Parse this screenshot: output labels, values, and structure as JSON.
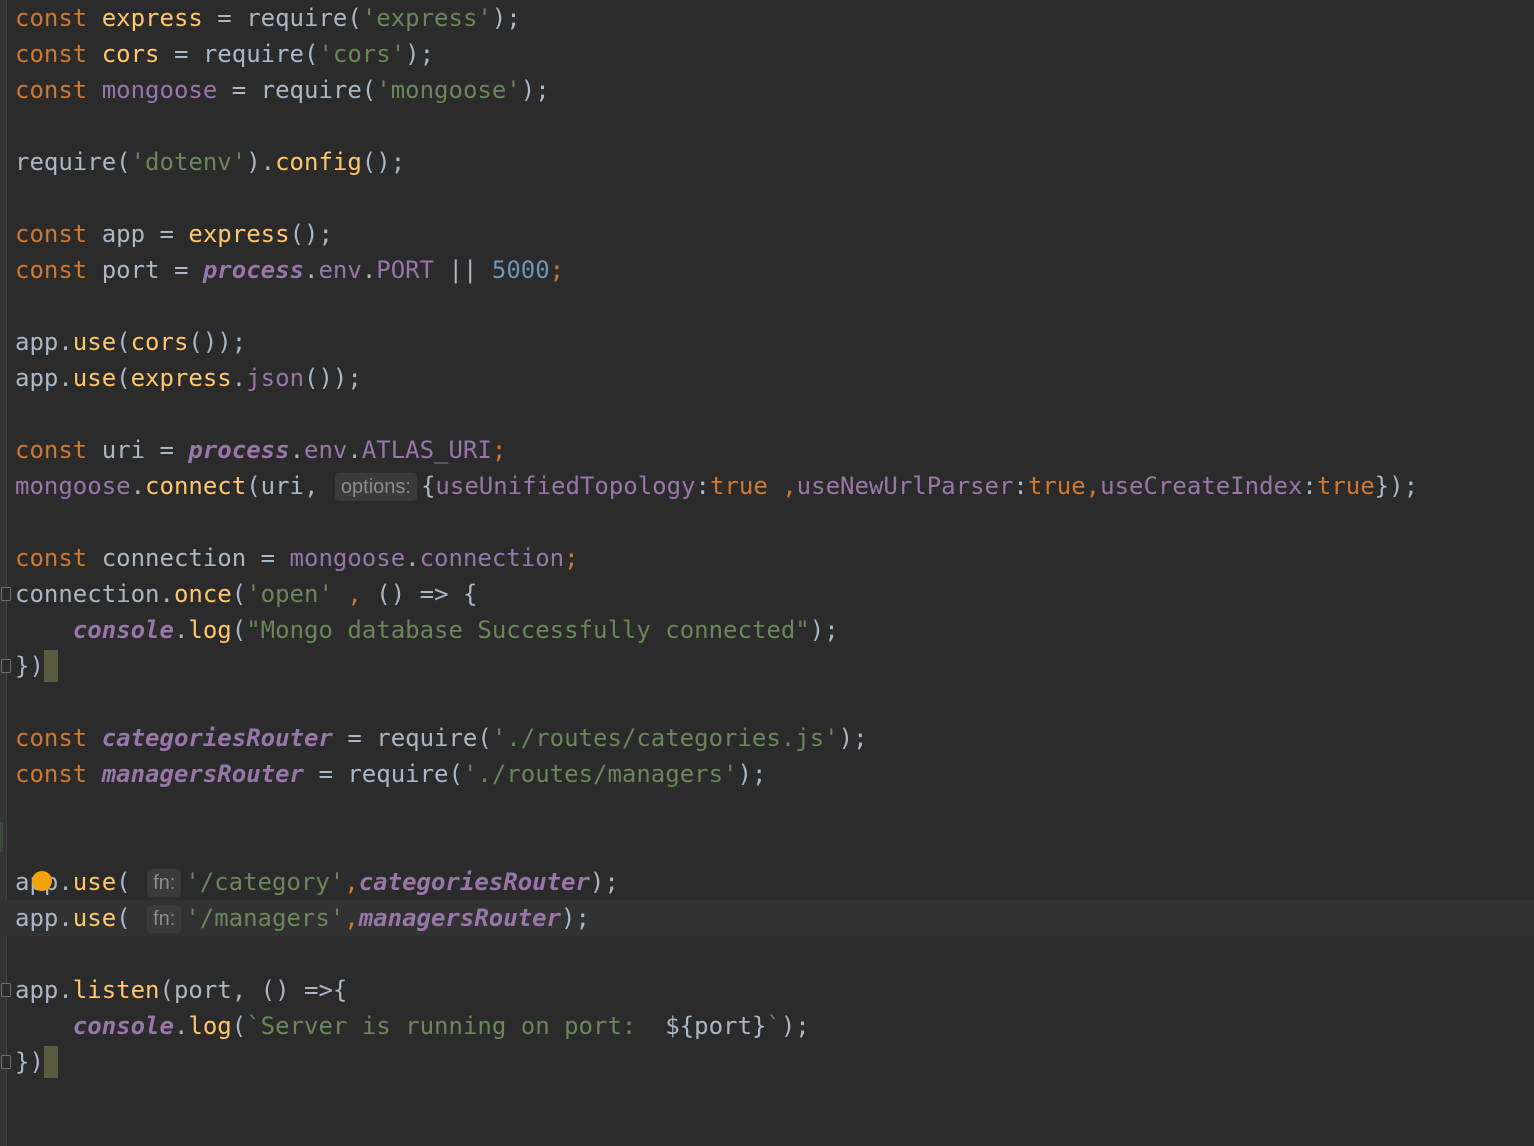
{
  "editor": {
    "language": "javascript",
    "current_line_index": 25,
    "lines": [
      [
        {
          "t": "const ",
          "c": "kw"
        },
        {
          "t": "express",
          "c": "fn"
        },
        {
          "t": " = require(",
          "c": "var"
        },
        {
          "t": "'express'",
          "c": "str"
        },
        {
          "t": ");",
          "c": "var"
        }
      ],
      [
        {
          "t": "const ",
          "c": "kw"
        },
        {
          "t": "cors",
          "c": "fn"
        },
        {
          "t": " = require(",
          "c": "var"
        },
        {
          "t": "'cors'",
          "c": "str"
        },
        {
          "t": ");",
          "c": "var"
        }
      ],
      [
        {
          "t": "const ",
          "c": "kw"
        },
        {
          "t": "mongoose",
          "c": "prop"
        },
        {
          "t": " = require(",
          "c": "var"
        },
        {
          "t": "'mongoose'",
          "c": "str"
        },
        {
          "t": ");",
          "c": "var"
        }
      ],
      [],
      [
        {
          "t": "require(",
          "c": "var"
        },
        {
          "t": "'dotenv'",
          "c": "str"
        },
        {
          "t": ").",
          "c": "var"
        },
        {
          "t": "config",
          "c": "fn"
        },
        {
          "t": "();",
          "c": "var"
        }
      ],
      [],
      [
        {
          "t": "const ",
          "c": "kw"
        },
        {
          "t": "app = ",
          "c": "var"
        },
        {
          "t": "express",
          "c": "fn"
        },
        {
          "t": "();",
          "c": "var"
        }
      ],
      [
        {
          "t": "const ",
          "c": "kw"
        },
        {
          "t": "port = ",
          "c": "var"
        },
        {
          "t": "process",
          "c": "glob"
        },
        {
          "t": ".",
          "c": "var"
        },
        {
          "t": "env",
          "c": "prop"
        },
        {
          "t": ".",
          "c": "var"
        },
        {
          "t": "PORT",
          "c": "prop"
        },
        {
          "t": " || ",
          "c": "var"
        },
        {
          "t": "5000",
          "c": "num"
        },
        {
          "t": ";",
          "c": "punc"
        }
      ],
      [],
      [
        {
          "t": "app.",
          "c": "var"
        },
        {
          "t": "use",
          "c": "fn"
        },
        {
          "t": "(",
          "c": "var"
        },
        {
          "t": "cors",
          "c": "fn"
        },
        {
          "t": "());",
          "c": "var"
        }
      ],
      [
        {
          "t": "app.",
          "c": "var"
        },
        {
          "t": "use",
          "c": "fn"
        },
        {
          "t": "(",
          "c": "var"
        },
        {
          "t": "express",
          "c": "fn"
        },
        {
          "t": ".",
          "c": "var"
        },
        {
          "t": "json",
          "c": "prop"
        },
        {
          "t": "());",
          "c": "var"
        }
      ],
      [],
      [
        {
          "t": "const ",
          "c": "kw"
        },
        {
          "t": "uri = ",
          "c": "var"
        },
        {
          "t": "process",
          "c": "glob"
        },
        {
          "t": ".",
          "c": "var"
        },
        {
          "t": "env",
          "c": "prop"
        },
        {
          "t": ".",
          "c": "var"
        },
        {
          "t": "ATLAS_URI",
          "c": "prop"
        },
        {
          "t": ";",
          "c": "punc"
        }
      ],
      [
        {
          "t": "mongoose",
          "c": "prop"
        },
        {
          "t": ".",
          "c": "var"
        },
        {
          "t": "connect",
          "c": "fn"
        },
        {
          "t": "(uri, ",
          "c": "var"
        },
        {
          "hint": "options:"
        },
        {
          "t": "{",
          "c": "var"
        },
        {
          "t": "useUnifiedTopology",
          "c": "prop"
        },
        {
          "t": ":",
          "c": "var"
        },
        {
          "t": "true",
          "c": "kw"
        },
        {
          "t": " ,",
          "c": "punc"
        },
        {
          "t": "useNewUrlParser",
          "c": "prop"
        },
        {
          "t": ":",
          "c": "var"
        },
        {
          "t": "true",
          "c": "kw"
        },
        {
          "t": ",",
          "c": "punc"
        },
        {
          "t": "useCreateIndex",
          "c": "prop"
        },
        {
          "t": ":",
          "c": "var"
        },
        {
          "t": "true",
          "c": "kw"
        },
        {
          "t": "});",
          "c": "var"
        }
      ],
      [],
      [
        {
          "t": "const ",
          "c": "kw"
        },
        {
          "t": "connection = ",
          "c": "var"
        },
        {
          "t": "mongoose",
          "c": "prop"
        },
        {
          "t": ".",
          "c": "var"
        },
        {
          "t": "connection",
          "c": "prop"
        },
        {
          "t": ";",
          "c": "punc"
        }
      ],
      [
        {
          "fold": true
        },
        {
          "t": "connection.",
          "c": "var"
        },
        {
          "t": "once",
          "c": "fn"
        },
        {
          "t": "(",
          "c": "var"
        },
        {
          "t": "'open'",
          "c": "str"
        },
        {
          "t": " , ",
          "c": "punc"
        },
        {
          "t": "() => {",
          "c": "var"
        }
      ],
      [
        {
          "t": "    ",
          "c": "var"
        },
        {
          "t": "console",
          "c": "glob"
        },
        {
          "t": ".",
          "c": "var"
        },
        {
          "t": "log",
          "c": "fn"
        },
        {
          "t": "(",
          "c": "var"
        },
        {
          "t": "\"Mongo database Successfully connected\"",
          "c": "str"
        },
        {
          "t": ");",
          "c": "var"
        }
      ],
      [
        {
          "fold": true
        },
        {
          "t": "})",
          "c": "var"
        },
        {
          "caret": true
        }
      ],
      [],
      [
        {
          "t": "const ",
          "c": "kw"
        },
        {
          "t": "categoriesRouter",
          "c": "glob"
        },
        {
          "t": " = require(",
          "c": "var"
        },
        {
          "t": "'./routes/categories.js'",
          "c": "str"
        },
        {
          "t": ");",
          "c": "var"
        }
      ],
      [
        {
          "t": "const ",
          "c": "kw"
        },
        {
          "t": "managersRouter",
          "c": "glob"
        },
        {
          "t": " = require(",
          "c": "var"
        },
        {
          "t": "'./routes/managers'",
          "c": "str"
        },
        {
          "t": ");",
          "c": "var"
        }
      ],
      [],
      [],
      [
        {
          "bulb": true
        },
        {
          "t": "app.",
          "c": "var"
        },
        {
          "t": "use",
          "c": "fn"
        },
        {
          "t": "( ",
          "c": "var"
        },
        {
          "hint": "fn:"
        },
        {
          "t": "'/category'",
          "c": "str"
        },
        {
          "t": ",",
          "c": "punc"
        },
        {
          "t": "categoriesRouter",
          "c": "glob"
        },
        {
          "t": ");",
          "c": "var"
        }
      ],
      [
        {
          "t": "app.",
          "c": "var"
        },
        {
          "t": "use",
          "c": "fn"
        },
        {
          "t": "( ",
          "c": "var"
        },
        {
          "hint": "fn:"
        },
        {
          "t": "'/managers'",
          "c": "str"
        },
        {
          "t": ",",
          "c": "punc"
        },
        {
          "t": "managersRouter",
          "c": "glob"
        },
        {
          "t": ");",
          "c": "var"
        }
      ],
      [],
      [
        {
          "fold": true
        },
        {
          "t": "app.",
          "c": "var"
        },
        {
          "t": "listen",
          "c": "fn"
        },
        {
          "t": "(port, ",
          "c": "var"
        },
        {
          "t": "() =>{",
          "c": "var"
        }
      ],
      [
        {
          "t": "    ",
          "c": "var"
        },
        {
          "t": "console",
          "c": "glob"
        },
        {
          "t": ".",
          "c": "var"
        },
        {
          "t": "log",
          "c": "fn"
        },
        {
          "t": "(",
          "c": "var"
        },
        {
          "t": "`Server is running on port:  ",
          "c": "str"
        },
        {
          "t": "${port}",
          "c": "var"
        },
        {
          "t": "`",
          "c": "str"
        },
        {
          "t": ");",
          "c": "var"
        }
      ],
      [
        {
          "fold": true
        },
        {
          "t": "})",
          "c": "var"
        },
        {
          "caret": true
        }
      ]
    ]
  }
}
